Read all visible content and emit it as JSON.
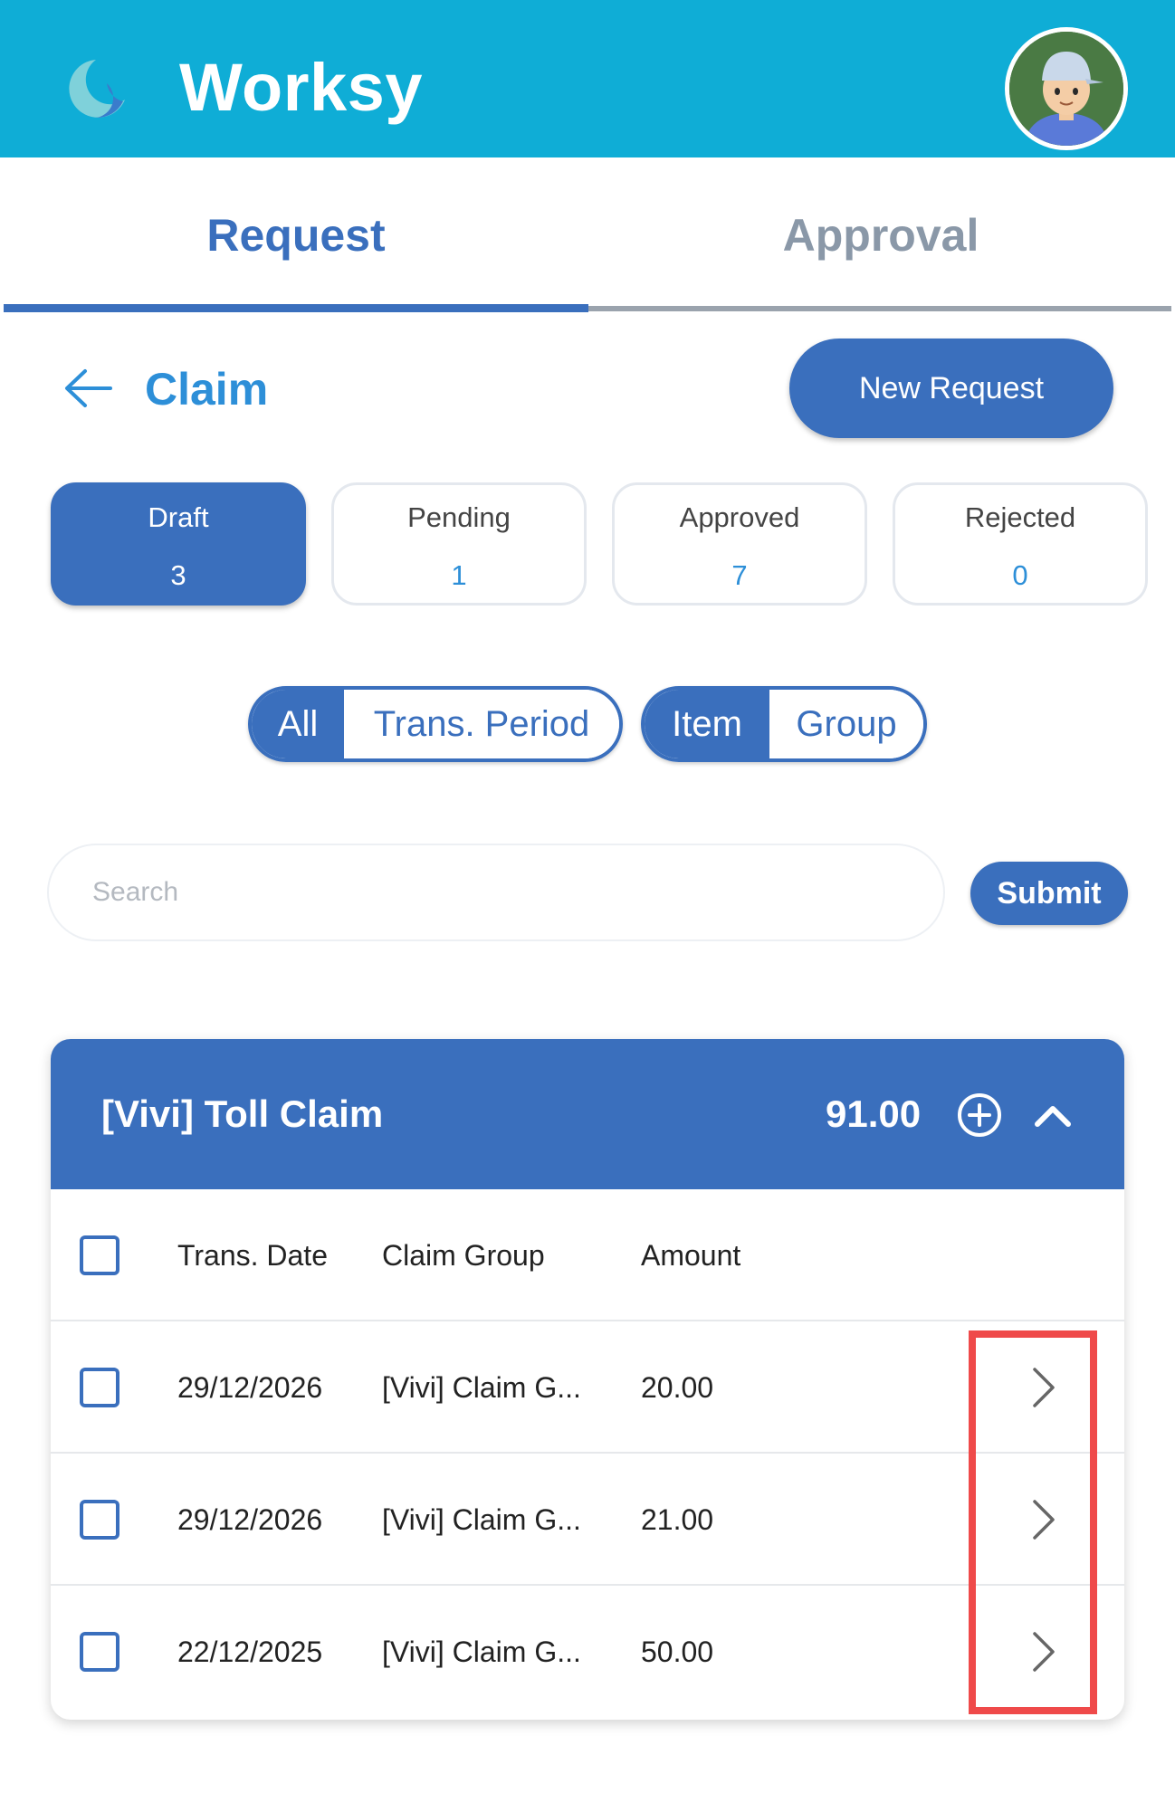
{
  "app": {
    "title": "Worksy"
  },
  "tabs": [
    {
      "label": "Request",
      "active": true
    },
    {
      "label": "Approval",
      "active": false
    }
  ],
  "page": {
    "title": "Claim",
    "new_request_label": "New Request"
  },
  "status_cards": [
    {
      "label": "Draft",
      "count": "3",
      "active": true
    },
    {
      "label": "Pending",
      "count": "1",
      "active": false
    },
    {
      "label": "Approved",
      "count": "7",
      "active": false
    },
    {
      "label": "Rejected",
      "count": "0",
      "active": false
    }
  ],
  "filters": {
    "period_toggle": {
      "all": "All",
      "trans_period": "Trans. Period",
      "selected": "All"
    },
    "group_toggle": {
      "item": "Item",
      "group": "Group",
      "selected": "Item"
    }
  },
  "search": {
    "placeholder": "Search",
    "value": "",
    "submit_label": "Submit"
  },
  "claim_group": {
    "title": "[Vivi] Toll Claim",
    "total": "91.00",
    "columns": {
      "date": "Trans. Date",
      "group": "Claim Group",
      "amount": "Amount"
    },
    "rows": [
      {
        "date": "29/12/2026",
        "group": "[Vivi] Claim G...",
        "amount": "20.00"
      },
      {
        "date": "29/12/2026",
        "group": "[Vivi] Claim G...",
        "amount": "21.00"
      },
      {
        "date": "22/12/2025",
        "group": "[Vivi] Claim G...",
        "amount": "50.00"
      }
    ]
  },
  "icons": {
    "logo": "moon-logo-icon",
    "avatar": "user-avatar",
    "back": "arrow-left-icon",
    "add": "plus-circle-icon",
    "collapse": "chevron-up-icon",
    "row_open": "chevron-right-icon"
  },
  "colors": {
    "header": "#0fadd6",
    "primary": "#3a6fbd",
    "accent_text": "#2d8fd8",
    "highlight": "#ef4a4a"
  }
}
